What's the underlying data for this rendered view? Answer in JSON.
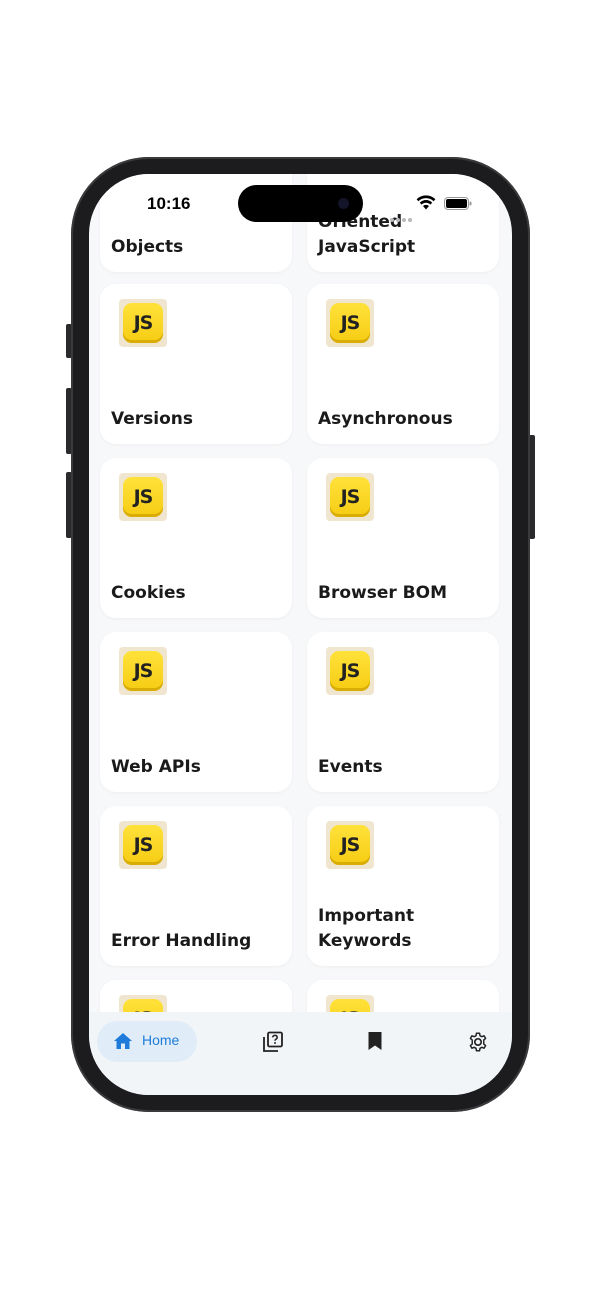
{
  "status_bar": {
    "time": "10:16"
  },
  "cards": [
    {
      "title": "Objects",
      "show_logo": false
    },
    {
      "title": "Oriented JavaScript",
      "show_logo": false
    },
    {
      "title": "Versions",
      "logo": "JS"
    },
    {
      "title": "Asynchronous",
      "logo": "JS"
    },
    {
      "title": "Cookies",
      "logo": "JS"
    },
    {
      "title": "Browser BOM",
      "logo": "JS"
    },
    {
      "title": "Web APIs",
      "logo": "JS"
    },
    {
      "title": "Events",
      "logo": "JS"
    },
    {
      "title": "Error Handling",
      "logo": "JS"
    },
    {
      "title": "Important Keywords",
      "logo": "JS"
    },
    {
      "title": "",
      "logo": "JS"
    },
    {
      "title": "",
      "logo": "JS"
    }
  ],
  "bottom_nav": {
    "items": [
      {
        "label": "Home",
        "icon": "home-icon",
        "active": true
      },
      {
        "label": "",
        "icon": "quiz-icon"
      },
      {
        "label": "",
        "icon": "bookmark-icon"
      },
      {
        "label": "",
        "icon": "settings-icon"
      }
    ]
  },
  "colors": {
    "accent": "#1e7bd9",
    "nav_pill": "#e0edf8",
    "js_yellow": "#f6cc13"
  }
}
